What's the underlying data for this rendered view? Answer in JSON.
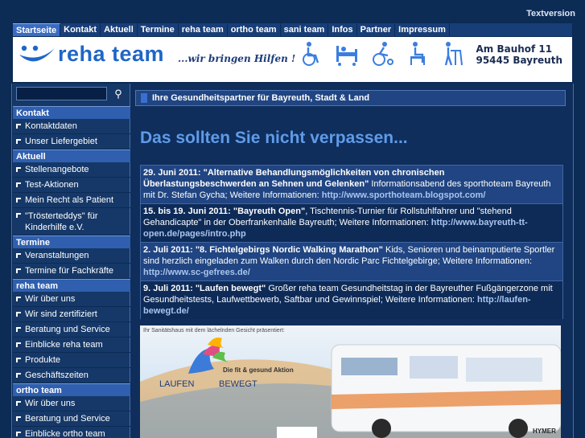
{
  "topbar": {
    "textversion": "Textversion"
  },
  "nav": [
    {
      "label": "Startseite",
      "active": true
    },
    {
      "label": "Kontakt"
    },
    {
      "label": "Aktuell"
    },
    {
      "label": "Termine"
    },
    {
      "label": "reha team"
    },
    {
      "label": "ortho team"
    },
    {
      "label": "sani team"
    },
    {
      "label": "Infos"
    },
    {
      "label": "Partner"
    },
    {
      "label": "Impressum"
    }
  ],
  "banner": {
    "brand": "reha team",
    "slogan": "...wir bringen Hilfen !",
    "address_line1": "Am Bauhof 11",
    "address_line2": "95445 Bayreuth",
    "icons": [
      "wheelchair-icon",
      "care-bed-icon",
      "sport-wheelchair-icon",
      "toilet-chair-icon",
      "walker-icon"
    ]
  },
  "search": {
    "value": "",
    "button_icon": "⚲"
  },
  "sidebar": {
    "sections": [
      {
        "title": "Kontakt",
        "items": [
          "Kontaktdaten",
          "Unser Liefergebiet"
        ]
      },
      {
        "title": "Aktuell",
        "items": [
          "Stellenangebote",
          "Test-Aktionen",
          "Mein Recht als Patient",
          "\"Trösterteddys\" für Kinderhilfe e.V."
        ]
      },
      {
        "title": "Termine",
        "items": [
          "Veranstaltungen",
          "Termine für Fachkräfte"
        ]
      },
      {
        "title": "reha team",
        "items": [
          "Wir über uns",
          "Wir sind zertifiziert",
          "Beratung und Service",
          "Einblicke reha team",
          "Produkte",
          "Geschäftszeiten"
        ]
      },
      {
        "title": "ortho team",
        "items": [
          "Wir über uns",
          "Beratung und Service",
          "Einblicke ortho team"
        ]
      }
    ]
  },
  "content": {
    "header": "Ihre Gesundheitspartner für Bayreuth, Stadt & Land",
    "page_title": "Das sollten Sie nicht verpassen...",
    "events": [
      {
        "date_title": "29. Juni 2011: \"Alternative Behandlungsmöglichkeiten von chronischen Überlastungsbeschwerden an Sehnen und Gelenken\"",
        "text": " Informationsabend des sporthoteam Bayreuth mit Dr. Stefan Gycha; Weitere Informationen: ",
        "url": "http://www.sporthoteam.blogspot.com/"
      },
      {
        "date_title": "15. bis 19. Juni 2011: \"Bayreuth Open\"",
        "text": ", Tischtennis-Turnier für Rollstuhlfahrer und \"stehend Gehandicapte\" in der Oberfrankenhalle Bayreuth; Weitere Informationen: ",
        "url": "http://www.bayreuth-tt-open.de/pages/intro.php"
      },
      {
        "date_title": "2. Juli 2011: \"8. Fichtelgebirgs Nordic Walking Marathon\"",
        "text": " Kids, Senioren und beinamputierte Sportler sind herzlich eingeladen zum Walken durch den Nordic Parc Fichtelgebirge; Weitere Informationen: ",
        "url": "http://www.sc-gefrees.de/"
      },
      {
        "date_title": "9. Juli 2011: \"Laufen bewegt\"",
        "text": " Großer reha team Gesundheitstag in der Bayreuther Fußgängerzone mit Gesundheitstests, Laufwettbewerb, Saftbar und Gewinnspiel; Weitere Informationen: ",
        "url": "http://laufen-bewegt.de/"
      }
    ],
    "photo": {
      "caption": "Ihr Sanitätshaus mit dem lächelnden Gesicht präsentiert:",
      "logo_top": "Die fit & gesund Aktion",
      "logo_left": "LAUFEN",
      "logo_right": "BEWEGT",
      "rv_brand": "HYMER"
    }
  }
}
